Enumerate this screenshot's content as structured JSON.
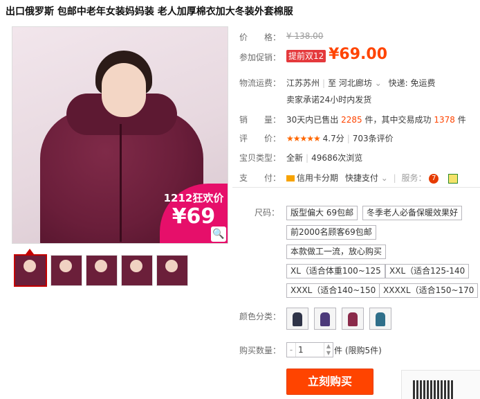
{
  "product": {
    "title": "出口俄罗斯 包邮中老年女装妈妈装 老人加厚棉衣加大冬装外套棉服",
    "promo_tag_line1": "1212狂欢价",
    "promo_tag_line2": "¥69"
  },
  "price": {
    "label": "价　　格：",
    "original": "¥ 138.00"
  },
  "promo": {
    "label": "参加促销：",
    "badge": "提前双12",
    "currency": "¥",
    "amount": "69.00"
  },
  "shipping": {
    "label": "物流运费：",
    "from": "江苏苏州",
    "to_prefix": "至",
    "to": "河北廊坊",
    "method": "快递: 免运费",
    "promise": "卖家承诺24小时内发货"
  },
  "sales": {
    "label": "销　　量：",
    "prefix": "30天内已售出",
    "sold": "2285",
    "middle": "件，其中交易成功",
    "success": "1378",
    "suffix": "件"
  },
  "rating": {
    "label": "评　　价：",
    "stars": "★★★★★",
    "score": "4.7分",
    "reviews": "703条评价"
  },
  "type": {
    "label": "宝贝类型：",
    "condition": "全新",
    "views": "49686次浏览"
  },
  "payment": {
    "label": "支　　付：",
    "credit": "信用卡分期",
    "quick": "快捷支付",
    "service_label": "服务：",
    "seven_icon_text": "7"
  },
  "sku": {
    "size_label": "尺码：",
    "options": [
      "版型偏大 69包邮",
      "冬季老人必备保暖效果好",
      "前2000名顾客69包邮",
      "本款做工一流，放心购买",
      "XL（适合体重100~125",
      "XXL（适合125-140",
      "XXXL（适合140~150",
      "XXXXL（适合150~170"
    ],
    "color_label": "颜色分类：",
    "swatch_colors": [
      "#2f3448",
      "#4c3a7a",
      "#8a2a4a",
      "#2f6f8a"
    ]
  },
  "quantity": {
    "label": "购买数量：",
    "minus": "-",
    "value": "1",
    "unit": "件",
    "limit": "(限购5件)"
  },
  "buy_button": "立刻购买",
  "icons": {
    "zoom": "🔍",
    "dropdown": "⌄"
  }
}
